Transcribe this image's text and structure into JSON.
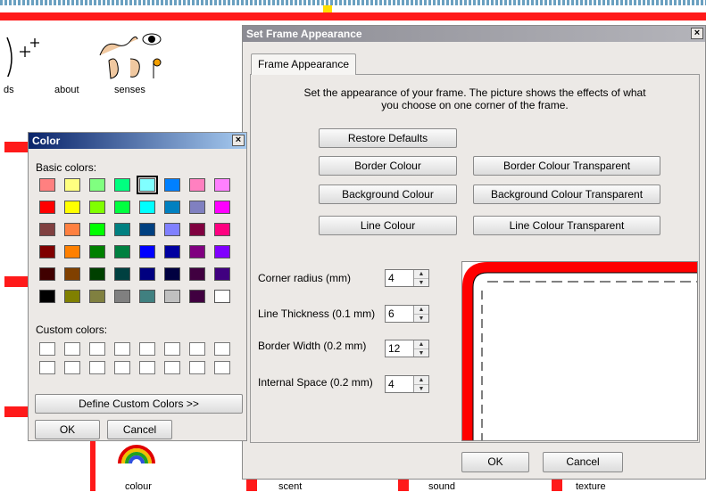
{
  "background": {
    "words": [
      "ds",
      "about",
      "senses",
      "colour",
      "scent",
      "sound",
      "texture"
    ]
  },
  "frame_dialog": {
    "title": "Set Frame Appearance",
    "close_glyph": "×",
    "tab_label": "Frame Appearance",
    "description": "Set the appearance of your frame. The picture shows the effects of what you choose on one corner of the frame.",
    "buttons": {
      "restore_defaults": "Restore Defaults",
      "border_colour": "Border Colour",
      "border_colour_transparent": "Border Colour Transparent",
      "background_colour": "Background Colour",
      "background_colour_transparent": "Background Colour Transparent",
      "line_colour": "Line Colour",
      "line_colour_transparent": "Line Colour Transparent",
      "ok": "OK",
      "cancel": "Cancel"
    },
    "fields": [
      {
        "label": "Corner radius (mm)",
        "value": "4"
      },
      {
        "label": "Line Thickness (0.1 mm)",
        "value": "6"
      },
      {
        "label": "Border Width (0.2 mm)",
        "value": "12"
      },
      {
        "label": "Internal Space (0.2 mm)",
        "value": "4"
      }
    ],
    "preview_border_color": "#ff0000"
  },
  "color_dialog": {
    "title": "Color",
    "close_glyph": "×",
    "basic_colors_label": "Basic colors:",
    "custom_colors_label": "Custom colors:",
    "define_custom_button": "Define Custom Colors >>",
    "ok_button": "OK",
    "cancel_button": "Cancel",
    "selected_index": 4,
    "basic_colors": [
      "#ff8080",
      "#ffff80",
      "#80ff80",
      "#00ff80",
      "#80ffff",
      "#0080ff",
      "#ff80c0",
      "#ff80ff",
      "#ff0000",
      "#ffff00",
      "#80ff00",
      "#00ff40",
      "#00ffff",
      "#0080c0",
      "#8080c0",
      "#ff00ff",
      "#804040",
      "#ff8040",
      "#00ff00",
      "#008080",
      "#004080",
      "#8080ff",
      "#800040",
      "#ff0080",
      "#800000",
      "#ff8000",
      "#008000",
      "#008040",
      "#0000ff",
      "#0000a0",
      "#800080",
      "#8000ff",
      "#400000",
      "#804000",
      "#004000",
      "#004040",
      "#000080",
      "#000040",
      "#400040",
      "#400080",
      "#000000",
      "#808000",
      "#808040",
      "#808080",
      "#408080",
      "#c0c0c0",
      "#400040",
      "#ffffff"
    ]
  }
}
